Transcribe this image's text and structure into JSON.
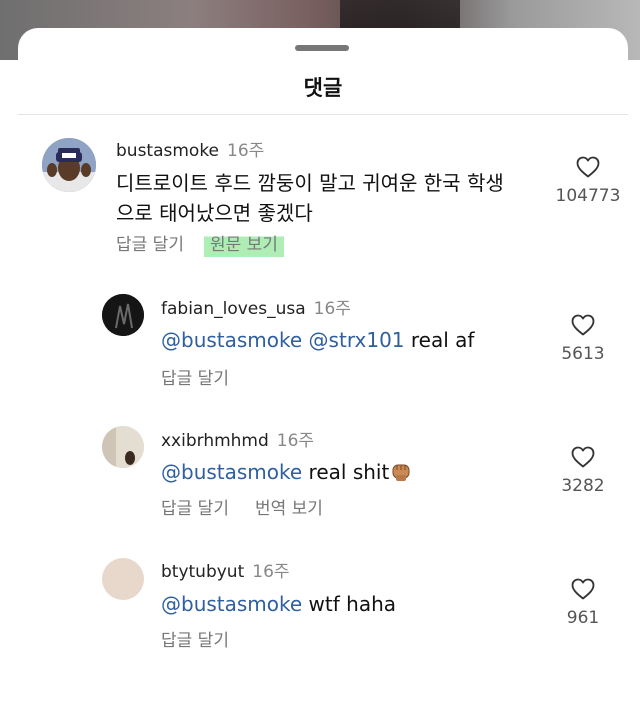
{
  "sheet": {
    "title": "댓글"
  },
  "comments": [
    {
      "username": "bustasmoke",
      "time": "16주",
      "text": "디트로이트 후드 깜둥이 말고 귀여운 한국 학생으로 태어났으면 좋겠다",
      "reply_label": "답글 달기",
      "view_original_label": "원문 보기",
      "likes": "104773"
    }
  ],
  "replies": [
    {
      "username": "fabian_loves_usa",
      "time": "16주",
      "mentions": "@bustasmoke @strx101",
      "body": " real af",
      "reply_label": "답글 달기",
      "likes": "5613"
    },
    {
      "username": "xxibrhmhmd",
      "time": "16주",
      "mentions": "@bustasmoke",
      "body": " real shit",
      "reply_label": "답글 달기",
      "translate_label": "번역 보기",
      "likes": "3282"
    },
    {
      "username": "btytubyut",
      "time": "16주",
      "mentions": "@bustasmoke",
      "body": " wtf haha",
      "reply_label": "답글 달기",
      "likes": "961"
    }
  ],
  "icons": {
    "like": "heart-outline-icon",
    "fist": "raised-fist-emoji"
  },
  "colors": {
    "mention": "#2f5f9e",
    "highlight": "#8ce696"
  }
}
